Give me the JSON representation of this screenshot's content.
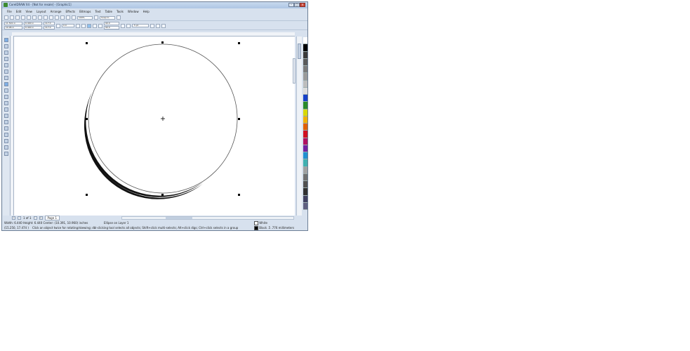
{
  "window": {
    "title": "CorelDRAW X4 - [Not for resale] - [Graphic1]",
    "min_label": "–",
    "max_label": "□",
    "close_label": "×"
  },
  "menu": [
    "File",
    "Edit",
    "View",
    "Layout",
    "Arrange",
    "Effects",
    "Bitmaps",
    "Text",
    "Table",
    "Tools",
    "Window",
    "Help"
  ],
  "toolbar": {
    "zoom_value": "100%",
    "snap_label": "Snap to"
  },
  "property_bar": {
    "x": "11.591 in",
    "y": "10.96 in",
    "width": "6.440 in",
    "height": "6.440 in",
    "scale_x": "117.0",
    "scale_y": "117.0",
    "angle": "0.0",
    "start_angle": "90.0",
    "end_angle": "90.0",
    "outline": ".5 pt"
  },
  "page_nav": {
    "page_count": "1 of 1",
    "page_tab": "Page 1"
  },
  "status": {
    "dimensions": "Width: 6.440  Height: 6.440  Center: (10.391, 10.960) inches",
    "object": "Ellipse on Layer 1",
    "cursor": "(15.250, 17.474 )",
    "hint": "Click an object twice for rotating/skewing; dbl-clicking tool selects all objects; Shift+click multi-selects; Alt+click digs; Ctrl+click selects in a group",
    "fill_label": "White",
    "outline_label": "Black  .5 .776 millimeters"
  },
  "palette_colors": [
    "#ffffff",
    "#000000",
    "#3a3a3a",
    "#5a5a5a",
    "#7a7a7a",
    "#9a9a9a",
    "#bdbdbd",
    "#dcdcdc",
    "#1540c8",
    "#2a8a2a",
    "#d8d800",
    "#f0b000",
    "#e06000",
    "#d01020",
    "#b01060",
    "#7020a0",
    "#2090d0",
    "#40b0b0",
    "#a0a0a0",
    "#707070",
    "#505050",
    "#303030",
    "#404060",
    "#606080"
  ]
}
